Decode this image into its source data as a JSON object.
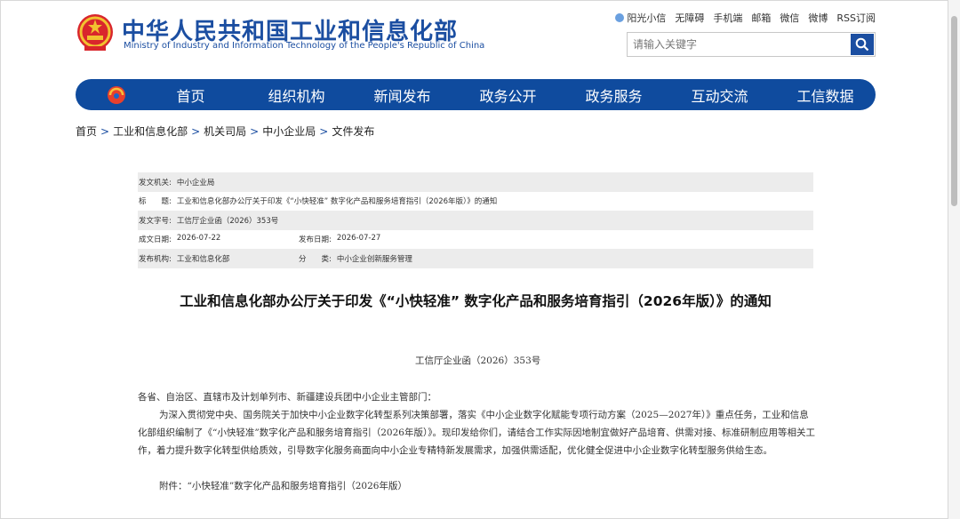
{
  "header": {
    "title_cn": "中华人民共和国工业和信息化部",
    "title_en": "Ministry of Industry and Information Technology of the People's Republic of China",
    "top_links": [
      "阳光小信",
      "无障碍",
      "手机端",
      "邮箱",
      "微信",
      "微博",
      "RSS订阅"
    ],
    "search_placeholder": "请输入关键字"
  },
  "nav": {
    "items": [
      "首页",
      "组织机构",
      "新闻发布",
      "政务公开",
      "政务服务",
      "互动交流",
      "工信数据"
    ]
  },
  "breadcrumb": [
    "首页",
    "工业和信息化部",
    "机关司局",
    "中小企业局",
    "文件发布"
  ],
  "breadcrumb_sep": ">",
  "meta": {
    "issuer_label": "发文机关:",
    "issuer": "中小企业局",
    "title_label": "标　　题:",
    "title": "工业和信息化部办公厅关于印发《“小快轻准” 数字化产品和服务培育指引（2026年版）》的通知",
    "docno_label": "发文字号:",
    "docno": "工信厅企业函（2026）353号",
    "created_label": "成文日期:",
    "created": "2026-07-22",
    "published_label": "发布日期:",
    "published": "2026-07-27",
    "agency_label": "发布机构:",
    "agency": "工业和信息化部",
    "category_label": "分　　类:",
    "category": "中小企业创新服务管理"
  },
  "article": {
    "title": "工业和信息化部办公厅关于印发《“小快轻准” 数字化产品和服务培育指引（2026年版）》的通知",
    "docno": "工信厅企业函（2026）353号",
    "salutation": "各省、自治区、直辖市及计划单列市、新疆建设兵团中小企业主管部门：",
    "paragraph": "为深入贯彻党中央、国务院关于加快中小企业数字化转型系列决策部署，落实《中小企业数字化赋能专项行动方案（2025—2027年）》重点任务，工业和信息化部组织编制了《“小快轻准”数字化产品和服务培育指引（2026年版）》。现印发给你们，请结合工作实际因地制宜做好产品培育、供需对接、标准研制应用等相关工作，着力提升数字化转型供给质效，引导数字化服务商面向中小企业专精特新发展需求，加强供需适配，优化健全促进中小企业数字化转型服务供给生态。",
    "attachment": "附件：“小快轻准”数字化产品和服务培育指引（2026年版）"
  },
  "colors": {
    "brand_blue": "#0f4b9e",
    "link_blue": "#1b4ea1",
    "meta_shade": "#ececec"
  }
}
